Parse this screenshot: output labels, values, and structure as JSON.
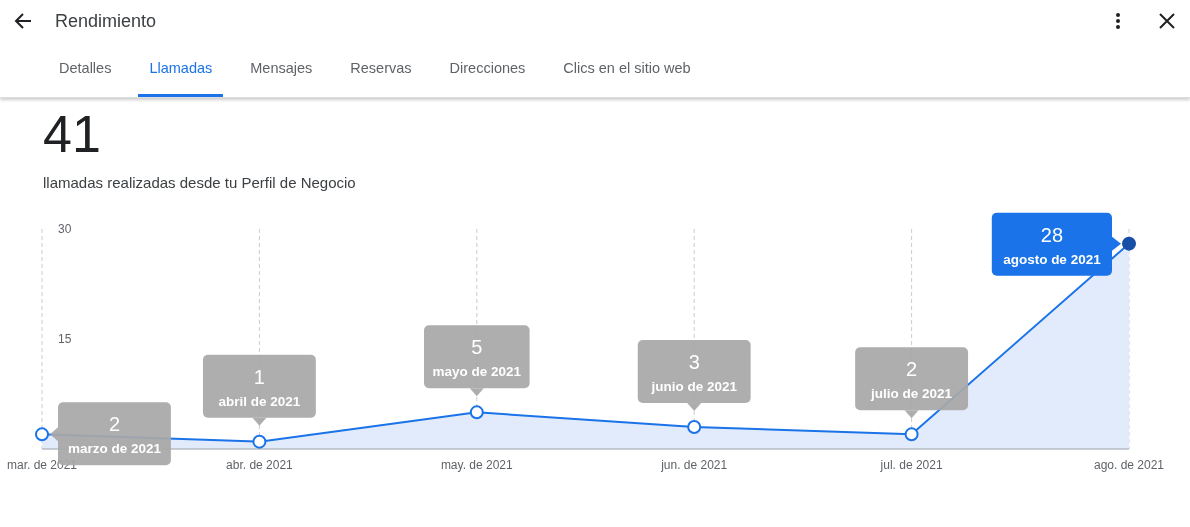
{
  "header": {
    "title": "Rendimiento"
  },
  "tabs": [
    {
      "label": "Detalles",
      "selected": false
    },
    {
      "label": "Llamadas",
      "selected": true
    },
    {
      "label": "Mensajes",
      "selected": false
    },
    {
      "label": "Reservas",
      "selected": false
    },
    {
      "label": "Direcciones",
      "selected": false
    },
    {
      "label": "Clics en el sitio web",
      "selected": false
    }
  ],
  "total": {
    "value": "41",
    "caption": "llamadas realizadas desde tu Perfil de Negocio"
  },
  "chart": {
    "chart_data": {
      "type": "area",
      "categories": [
        "mar. de 2021",
        "abr. de 2021",
        "may. de 2021",
        "jun. de 2021",
        "jul. de 2021",
        "ago. de 2021"
      ],
      "series": [
        {
          "color": "#1a73e8",
          "values": [
            2,
            1,
            5,
            3,
            2,
            28
          ]
        }
      ],
      "ylim": [
        0,
        30
      ],
      "yticks": [
        15,
        30
      ],
      "grid": true
    },
    "tooltips": [
      {
        "value": "2",
        "label": "marzo de 2021",
        "selected": false
      },
      {
        "value": "1",
        "label": "abril de 2021",
        "selected": false
      },
      {
        "value": "5",
        "label": "mayo de 2021",
        "selected": false
      },
      {
        "value": "3",
        "label": "junio de 2021",
        "selected": false
      },
      {
        "value": "2",
        "label": "julio de 2021",
        "selected": false
      },
      {
        "value": "28",
        "label": "agosto de 2021",
        "selected": true
      }
    ]
  }
}
